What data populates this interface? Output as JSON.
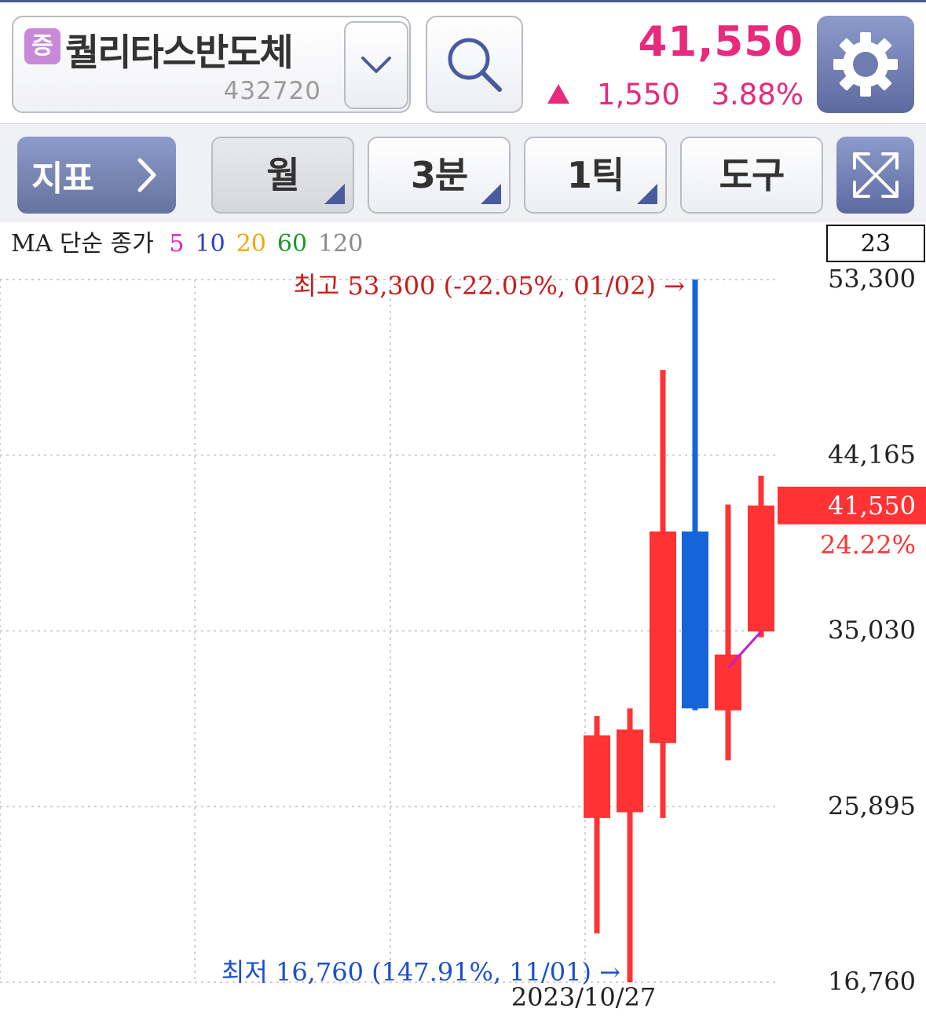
{
  "stock": {
    "badge": "증",
    "name": "퀄리타스반도체",
    "code": "432720",
    "price": "41,550",
    "change": "1,550",
    "change_pct": "3.88%",
    "direction": "up"
  },
  "toolbar": {
    "indicator_label": "지표",
    "period_label": "월",
    "minute_label": "3분",
    "tick_label": "1틱",
    "tools_label": "도구"
  },
  "legend": {
    "prefix": "MA 단순 종가",
    "ma": [
      {
        "label": "5",
        "color": "#e020c8"
      },
      {
        "label": "10",
        "color": "#2a3fc9"
      },
      {
        "label": "20",
        "color": "#f0a800"
      },
      {
        "label": "60",
        "color": "#1a9a2a"
      },
      {
        "label": "120",
        "color": "#8a8a8a"
      }
    ]
  },
  "colors": {
    "up": "#ff3333",
    "down": "#1565d8",
    "accent": "#e8297c",
    "ma5": "#c020c8"
  },
  "chart_data": {
    "type": "candlestick",
    "y_axis_labels": [
      "53,300",
      "44,165",
      "35,030",
      "25,895",
      "16,760"
    ],
    "y_axis_values": [
      53300,
      44165,
      35030,
      25895,
      16760
    ],
    "ylim": [
      16760,
      53300
    ],
    "count_label": "23",
    "x_label": "2023/10/27",
    "current_price_label": "41,550",
    "current_pct_label": "24.22%",
    "high_annotation": "최고 53,300 (-22.05%, 01/02) →",
    "low_annotation": "최저 16,760 (147.91%, 11/01) →",
    "candles": [
      {
        "open": 25300,
        "close": 29600,
        "high": 30600,
        "low": 19300
      },
      {
        "open": 25600,
        "close": 29900,
        "high": 31000,
        "low": 16760
      },
      {
        "open": 29200,
        "close": 40200,
        "high": 48600,
        "low": 25300
      },
      {
        "open": 40200,
        "close": 31000,
        "high": 53300,
        "low": 30900
      },
      {
        "open": 30900,
        "close": 33800,
        "high": 41600,
        "low": 28300
      },
      {
        "open": 35000,
        "close": 41550,
        "high": 43100,
        "low": 34700
      }
    ],
    "ma5": [
      {
        "candle": 4,
        "value": 33100
      },
      {
        "candle": 5,
        "value": 35000
      }
    ]
  }
}
